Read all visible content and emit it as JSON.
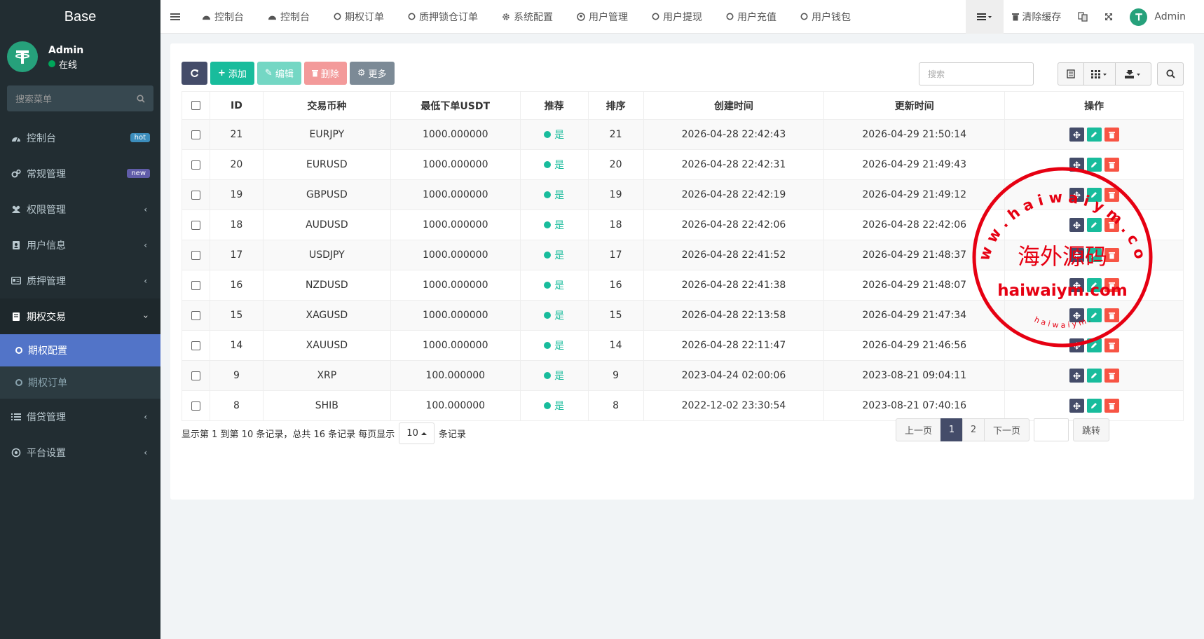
{
  "brand": "Base",
  "user": {
    "name": "Admin",
    "status": "在线"
  },
  "sidebar": {
    "search_placeholder": "搜索菜单",
    "items": [
      {
        "label": "控制台",
        "badge": "hot",
        "badge_color": "#3c8dbc"
      },
      {
        "label": "常规管理",
        "badge": "new",
        "badge_color": "#605ca8"
      },
      {
        "label": "权限管理"
      },
      {
        "label": "用户信息"
      },
      {
        "label": "质押管理"
      },
      {
        "label": "期权交易"
      },
      {
        "label": "借贷管理"
      },
      {
        "label": "平台设置"
      }
    ],
    "submenu": [
      {
        "label": "期权配置"
      },
      {
        "label": "期权订单"
      }
    ]
  },
  "topnav": {
    "items": [
      "控制台",
      "控制台",
      "期权订单",
      "质押锁仓订单",
      "系统配置",
      "用户管理",
      "用户提现",
      "用户充值",
      "用户钱包"
    ],
    "clear_cache": "清除缓存",
    "admin": "Admin"
  },
  "toolbar": {
    "add": "添加",
    "edit": "编辑",
    "delete": "删除",
    "more": "更多",
    "search_placeholder": "搜索"
  },
  "table": {
    "headers": [
      "ID",
      "交易币种",
      "最低下单USDT",
      "推荐",
      "排序",
      "创建时间",
      "更新时间",
      "操作"
    ],
    "rows": [
      {
        "id": "21",
        "symbol": "EURJPY",
        "min": "1000.000000",
        "rec": "是",
        "sort": "21",
        "created": "2026-04-28 22:42:43",
        "updated": "2026-04-29 21:50:14"
      },
      {
        "id": "20",
        "symbol": "EURUSD",
        "min": "1000.000000",
        "rec": "是",
        "sort": "20",
        "created": "2026-04-28 22:42:31",
        "updated": "2026-04-29 21:49:43"
      },
      {
        "id": "19",
        "symbol": "GBPUSD",
        "min": "1000.000000",
        "rec": "是",
        "sort": "19",
        "created": "2026-04-28 22:42:19",
        "updated": "2026-04-29 21:49:12"
      },
      {
        "id": "18",
        "symbol": "AUDUSD",
        "min": "1000.000000",
        "rec": "是",
        "sort": "18",
        "created": "2026-04-28 22:42:06",
        "updated": "2026-04-28 22:42:06"
      },
      {
        "id": "17",
        "symbol": "USDJPY",
        "min": "1000.000000",
        "rec": "是",
        "sort": "17",
        "created": "2026-04-28 22:41:52",
        "updated": "2026-04-29 21:48:37"
      },
      {
        "id": "16",
        "symbol": "NZDUSD",
        "min": "1000.000000",
        "rec": "是",
        "sort": "16",
        "created": "2026-04-28 22:41:38",
        "updated": "2026-04-29 21:48:07"
      },
      {
        "id": "15",
        "symbol": "XAGUSD",
        "min": "1000.000000",
        "rec": "是",
        "sort": "15",
        "created": "2026-04-28 22:13:58",
        "updated": "2026-04-29 21:47:34"
      },
      {
        "id": "14",
        "symbol": "XAUUSD",
        "min": "1000.000000",
        "rec": "是",
        "sort": "14",
        "created": "2026-04-28 22:11:47",
        "updated": "2026-04-29 21:46:56"
      },
      {
        "id": "9",
        "symbol": "XRP",
        "min": "100.000000",
        "rec": "是",
        "sort": "9",
        "created": "2023-04-24 02:00:06",
        "updated": "2023-08-21 09:04:11"
      },
      {
        "id": "8",
        "symbol": "SHIB",
        "min": "100.000000",
        "rec": "是",
        "sort": "8",
        "created": "2022-12-02 23:30:54",
        "updated": "2023-08-21 07:40:16"
      }
    ]
  },
  "pagination": {
    "info_prefix": "显示第 1 到第 10 条记录，总共 16 条记录 每页显示",
    "page_size": "10",
    "info_suffix": "条记录",
    "prev": "上一页",
    "p1": "1",
    "p2": "2",
    "next": "下一页",
    "jump": "跳转"
  },
  "watermark": {
    "top": "w w w . h a i w a i y m . c o m",
    "middle": "海外源码",
    "lower": "haiwaiym.com",
    "bottom": "h a i w a i y m .",
    "color": "#e60012"
  }
}
